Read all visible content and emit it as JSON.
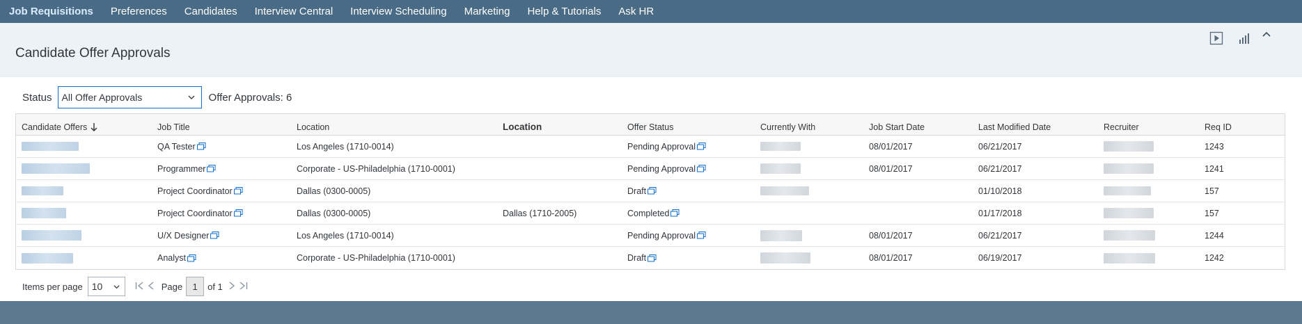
{
  "nav": {
    "items": [
      "Job Requisitions",
      "Preferences",
      "Candidates",
      "Interview Central",
      "Interview Scheduling",
      "Marketing",
      "Help & Tutorials",
      "Ask HR"
    ]
  },
  "header": {
    "title": "Candidate Offer Approvals",
    "icons": [
      "play-icon",
      "bar-chart-icon",
      "collapse-chevron-icon"
    ]
  },
  "filter": {
    "status_label": "Status",
    "status_value": "All Offer Approvals",
    "count_label": "Offer Approvals: 6"
  },
  "table": {
    "headers": [
      "Candidate Offers",
      "Job Title",
      "Location",
      "Location",
      "Offer Status",
      "Currently With",
      "Job Start Date",
      "Last Modified Date",
      "Recruiter",
      "Req ID"
    ],
    "rows": [
      {
        "job_title": "QA Tester",
        "location": "Los Angeles (1710-0014)",
        "location2": "",
        "status": "Pending Approval",
        "start": "08/01/2017",
        "modified": "06/21/2017",
        "req": "1243"
      },
      {
        "job_title": "Programmer",
        "location": "Corporate - US-Philadelphia (1710-0001)",
        "location2": "",
        "status": "Pending Approval",
        "start": "08/01/2017",
        "modified": "06/21/2017",
        "req": "1241"
      },
      {
        "job_title": "Project Coordinator",
        "location": "Dallas (0300-0005)",
        "location2": "",
        "status": "Draft",
        "start": "",
        "modified": "01/10/2018",
        "req": "157"
      },
      {
        "job_title": "Project Coordinator",
        "location": "Dallas (0300-0005)",
        "location2": "Dallas (1710-2005)",
        "status": "Completed",
        "start": "",
        "modified": "01/17/2018",
        "req": "157"
      },
      {
        "job_title": "U/X Designer",
        "location": "Los Angeles (1710-0014)",
        "location2": "",
        "status": "Pending Approval",
        "start": "08/01/2017",
        "modified": "06/21/2017",
        "req": "1244"
      },
      {
        "job_title": "Analyst",
        "location": "Corporate - US-Philadelphia (1710-0001)",
        "location2": "",
        "status": "Draft",
        "start": "08/01/2017",
        "modified": "06/19/2017",
        "req": "1242"
      }
    ]
  },
  "pager": {
    "items_label": "Items per page",
    "items_value": "10",
    "page_label": "Page",
    "page_value": "1",
    "of_label": "of 1"
  }
}
